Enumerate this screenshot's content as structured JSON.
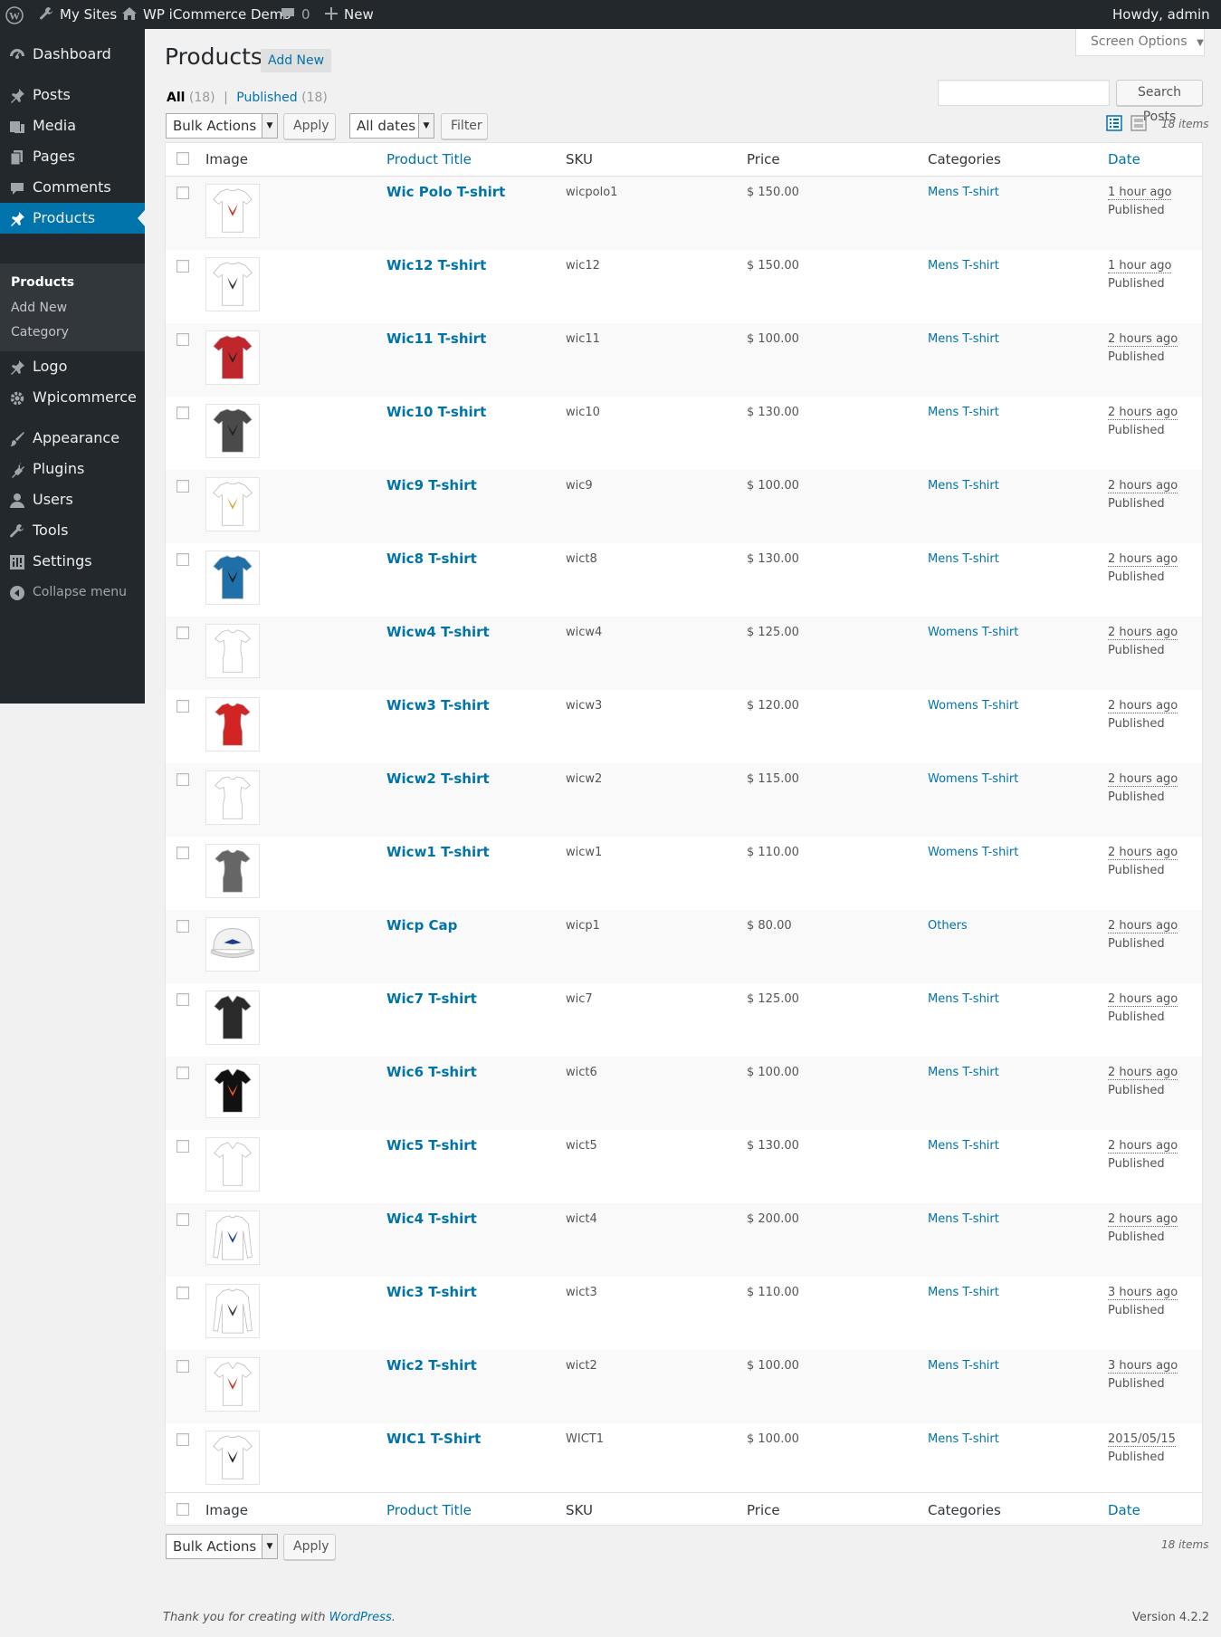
{
  "adminbar": {
    "my_sites": "My Sites",
    "site_name": "WP iCommerce Demo",
    "comments_count": "0",
    "new_label": "New",
    "howdy": "Howdy, admin"
  },
  "menu": {
    "items": [
      {
        "label": "Dashboard",
        "icon": "dashboard-icon"
      },
      {
        "label": "Posts",
        "icon": "pin-icon"
      },
      {
        "label": "Media",
        "icon": "media-icon"
      },
      {
        "label": "Pages",
        "icon": "pages-icon"
      },
      {
        "label": "Comments",
        "icon": "comment-icon"
      },
      {
        "label": "Products",
        "icon": "pin-icon"
      },
      {
        "label": "Logo",
        "icon": "pin-icon"
      },
      {
        "label": "Wpicommerce",
        "icon": "gear-icon"
      },
      {
        "label": "Appearance",
        "icon": "brush-icon"
      },
      {
        "label": "Plugins",
        "icon": "plug-icon"
      },
      {
        "label": "Users",
        "icon": "user-icon"
      },
      {
        "label": "Tools",
        "icon": "wrench-icon"
      },
      {
        "label": "Settings",
        "icon": "settings-icon"
      }
    ],
    "submenu": [
      "Products",
      "Add New",
      "Category"
    ],
    "collapse": "Collapse menu"
  },
  "page": {
    "title": "Products",
    "add_new": "Add New",
    "screen_options": "Screen Options",
    "views": {
      "all": "All",
      "all_count": "(18)",
      "published": "Published",
      "published_count": "(18)"
    },
    "search_button": "Search Posts",
    "bulk_actions": "Bulk Actions",
    "apply": "Apply",
    "all_dates": "All dates",
    "filter": "Filter",
    "items_count": "18 items"
  },
  "table": {
    "headers": {
      "image": "Image",
      "title": "Product Title",
      "sku": "SKU",
      "price": "Price",
      "categories": "Categories",
      "date": "Date"
    },
    "rows": [
      {
        "title": "Wic Polo T-shirt",
        "sku": "wicpolo1",
        "price": "$ 150.00",
        "category": "Mens T-shirt",
        "date": "1 hour ago",
        "status": "Published",
        "shirt_color": "#ffffff",
        "print_color": "#c0392b",
        "kind": "tee"
      },
      {
        "title": "Wic12 T-shirt",
        "sku": "wic12",
        "price": "$ 150.00",
        "category": "Mens T-shirt",
        "date": "1 hour ago",
        "status": "Published",
        "shirt_color": "#ffffff",
        "print_color": "#333333",
        "kind": "tee"
      },
      {
        "title": "Wic11 T-shirt",
        "sku": "wic11",
        "price": "$ 100.00",
        "category": "Mens T-shirt",
        "date": "2 hours ago",
        "status": "Published",
        "shirt_color": "#c0272d",
        "print_color": "#222222",
        "kind": "tee"
      },
      {
        "title": "Wic10 T-shirt",
        "sku": "wic10",
        "price": "$ 130.00",
        "category": "Mens T-shirt",
        "date": "2 hours ago",
        "status": "Published",
        "shirt_color": "#4a4a4a",
        "print_color": "#222222",
        "kind": "tee"
      },
      {
        "title": "Wic9 T-shirt",
        "sku": "wic9",
        "price": "$ 100.00",
        "category": "Mens T-shirt",
        "date": "2 hours ago",
        "status": "Published",
        "shirt_color": "#ffffff",
        "print_color": "#d4b04c",
        "kind": "tee"
      },
      {
        "title": "Wic8 T-shirt",
        "sku": "wict8",
        "price": "$ 130.00",
        "category": "Mens T-shirt",
        "date": "2 hours ago",
        "status": "Published",
        "shirt_color": "#1f6fa8",
        "print_color": "#1a1a1a",
        "kind": "tee"
      },
      {
        "title": "Wicw4 T-shirt",
        "sku": "wicw4",
        "price": "$ 125.00",
        "category": "Womens T-shirt",
        "date": "2 hours ago",
        "status": "Published",
        "shirt_color": "#ffffff",
        "print_color": "#ffffff",
        "kind": "women"
      },
      {
        "title": "Wicw3 T-shirt",
        "sku": "wicw3",
        "price": "$ 120.00",
        "category": "Womens T-shirt",
        "date": "2 hours ago",
        "status": "Published",
        "shirt_color": "#d32424",
        "print_color": "#d32424",
        "kind": "women"
      },
      {
        "title": "Wicw2 T-shirt",
        "sku": "wicw2",
        "price": "$ 115.00",
        "category": "Womens T-shirt",
        "date": "2 hours ago",
        "status": "Published",
        "shirt_color": "#ffffff",
        "print_color": "#ffffff",
        "kind": "women"
      },
      {
        "title": "Wicw1 T-shirt",
        "sku": "wicw1",
        "price": "$ 110.00",
        "category": "Womens T-shirt",
        "date": "2 hours ago",
        "status": "Published",
        "shirt_color": "#666666",
        "print_color": "#666666",
        "kind": "women"
      },
      {
        "title": "Wicp Cap",
        "sku": "wicp1",
        "price": "$ 80.00",
        "category": "Others",
        "date": "2 hours ago",
        "status": "Published",
        "shirt_color": "#f2f2f2",
        "print_color": "#1a3c8a",
        "kind": "cap"
      },
      {
        "title": "Wic7 T-shirt",
        "sku": "wic7",
        "price": "$ 125.00",
        "category": "Mens T-shirt",
        "date": "2 hours ago",
        "status": "Published",
        "shirt_color": "#2a2a2a",
        "print_color": "#2a2a2a",
        "kind": "polo"
      },
      {
        "title": "Wic6 T-shirt",
        "sku": "wict6",
        "price": "$ 100.00",
        "category": "Mens T-shirt",
        "date": "2 hours ago",
        "status": "Published",
        "shirt_color": "#111111",
        "print_color": "#e8541e",
        "kind": "polo"
      },
      {
        "title": "Wic5 T-shirt",
        "sku": "wict5",
        "price": "$ 130.00",
        "category": "Mens T-shirt",
        "date": "2 hours ago",
        "status": "Published",
        "shirt_color": "#ffffff",
        "print_color": "#ffffff",
        "kind": "polo"
      },
      {
        "title": "Wic4 T-shirt",
        "sku": "wict4",
        "price": "$ 200.00",
        "category": "Mens T-shirt",
        "date": "2 hours ago",
        "status": "Published",
        "shirt_color": "#ffffff",
        "print_color": "#1a3c8a",
        "kind": "long"
      },
      {
        "title": "Wic3 T-shirt",
        "sku": "wict3",
        "price": "$ 110.00",
        "category": "Mens T-shirt",
        "date": "3 hours ago",
        "status": "Published",
        "shirt_color": "#ffffff",
        "print_color": "#333333",
        "kind": "long"
      },
      {
        "title": "Wic2 T-shirt",
        "sku": "wict2",
        "price": "$ 100.00",
        "category": "Mens T-shirt",
        "date": "3 hours ago",
        "status": "Published",
        "shirt_color": "#ffffff",
        "print_color": "#c0392b",
        "kind": "polo"
      },
      {
        "title": "WIC1 T-Shirt",
        "sku": "WICT1",
        "price": "$ 100.00",
        "category": "Mens T-shirt",
        "date": "2015/05/15",
        "status": "Published",
        "shirt_color": "#ffffff",
        "print_color": "#222222",
        "kind": "tee"
      }
    ]
  },
  "footer": {
    "thanks": "Thank you for creating with",
    "wordpress": "WordPress",
    "period": ".",
    "version": "Version 4.2.2"
  },
  "colors": {
    "accent": "#0073aa",
    "admin_bar": "#23282d",
    "page_bg": "#f1f1f1"
  }
}
